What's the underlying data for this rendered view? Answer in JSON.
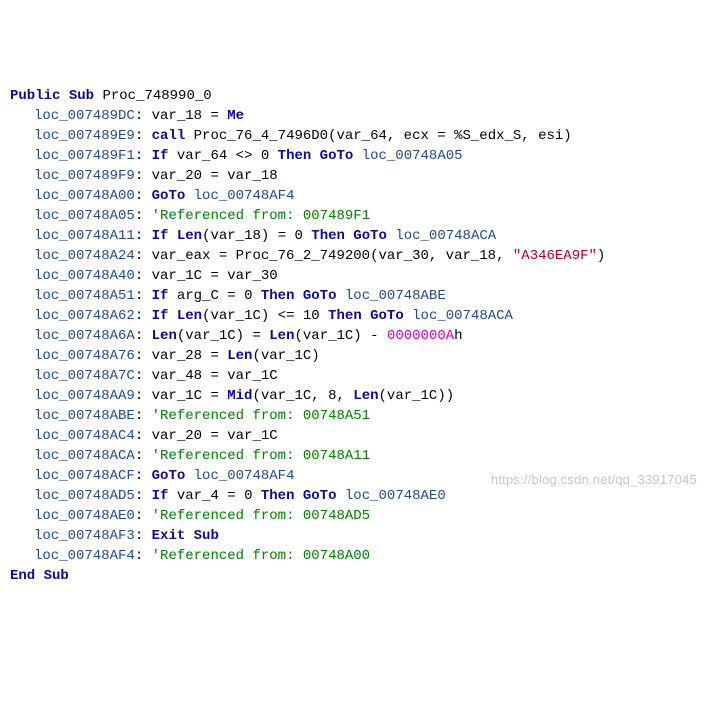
{
  "watermark": "https://blog.csdn.net/qq_33917045",
  "lines": [
    {
      "indent": false,
      "tokens": [
        {
          "t": "Public",
          "c": "kw"
        },
        {
          "t": " ",
          "c": "txt"
        },
        {
          "t": "Sub",
          "c": "kw"
        },
        {
          "t": " Proc_748990_0",
          "c": "txt"
        }
      ]
    },
    {
      "indent": true,
      "tokens": [
        {
          "t": "loc_007489DC",
          "c": "loc"
        },
        {
          "t": ": var_18 = ",
          "c": "txt"
        },
        {
          "t": "Me",
          "c": "kw"
        }
      ]
    },
    {
      "indent": true,
      "tokens": [
        {
          "t": "loc_007489E9",
          "c": "loc"
        },
        {
          "t": ": ",
          "c": "txt"
        },
        {
          "t": "call",
          "c": "kw"
        },
        {
          "t": " Proc_76_4_7496D0(var_64, ecx = %S_edx_S, esi)",
          "c": "txt"
        }
      ]
    },
    {
      "indent": true,
      "tokens": [
        {
          "t": "loc_007489F1",
          "c": "loc"
        },
        {
          "t": ": ",
          "c": "txt"
        },
        {
          "t": "If",
          "c": "kw"
        },
        {
          "t": " var_64 <> 0 ",
          "c": "txt"
        },
        {
          "t": "Then GoTo",
          "c": "kw"
        },
        {
          "t": " ",
          "c": "txt"
        },
        {
          "t": "loc_00748A05",
          "c": "loc"
        }
      ]
    },
    {
      "indent": true,
      "tokens": [
        {
          "t": "loc_007489F9",
          "c": "loc"
        },
        {
          "t": ": var_20 = var_18",
          "c": "txt"
        }
      ]
    },
    {
      "indent": true,
      "tokens": [
        {
          "t": "loc_00748A00",
          "c": "loc"
        },
        {
          "t": ": ",
          "c": "txt"
        },
        {
          "t": "GoTo",
          "c": "kw"
        },
        {
          "t": " ",
          "c": "txt"
        },
        {
          "t": "loc_00748AF4",
          "c": "loc"
        }
      ]
    },
    {
      "indent": true,
      "tokens": [
        {
          "t": "loc_00748A05",
          "c": "loc"
        },
        {
          "t": ": ",
          "c": "txt"
        },
        {
          "t": "'Referenced from: 007489F1",
          "c": "cm"
        }
      ]
    },
    {
      "indent": true,
      "tokens": [
        {
          "t": "loc_00748A11",
          "c": "loc"
        },
        {
          "t": ": ",
          "c": "txt"
        },
        {
          "t": "If",
          "c": "kw"
        },
        {
          "t": " ",
          "c": "txt"
        },
        {
          "t": "Len",
          "c": "kw"
        },
        {
          "t": "(var_18) = 0 ",
          "c": "txt"
        },
        {
          "t": "Then GoTo",
          "c": "kw"
        },
        {
          "t": " ",
          "c": "txt"
        },
        {
          "t": "loc_00748ACA",
          "c": "loc"
        }
      ]
    },
    {
      "indent": true,
      "tokens": [
        {
          "t": "loc_00748A24",
          "c": "loc"
        },
        {
          "t": ": var_eax = Proc_76_2_749200(var_30, var_18, ",
          "c": "txt"
        },
        {
          "t": "\"A346EA9F\"",
          "c": "str"
        },
        {
          "t": ")",
          "c": "txt"
        }
      ]
    },
    {
      "indent": true,
      "tokens": [
        {
          "t": "loc_00748A40",
          "c": "loc"
        },
        {
          "t": ": var_1C = var_30",
          "c": "txt"
        }
      ]
    },
    {
      "indent": true,
      "tokens": [
        {
          "t": "loc_00748A51",
          "c": "loc"
        },
        {
          "t": ": ",
          "c": "txt"
        },
        {
          "t": "If",
          "c": "kw"
        },
        {
          "t": " arg_C = 0 ",
          "c": "txt"
        },
        {
          "t": "Then GoTo",
          "c": "kw"
        },
        {
          "t": " ",
          "c": "txt"
        },
        {
          "t": "loc_00748ABE",
          "c": "loc"
        }
      ]
    },
    {
      "indent": true,
      "tokens": [
        {
          "t": "loc_00748A62",
          "c": "loc"
        },
        {
          "t": ": ",
          "c": "txt"
        },
        {
          "t": "If",
          "c": "kw"
        },
        {
          "t": " ",
          "c": "txt"
        },
        {
          "t": "Len",
          "c": "kw"
        },
        {
          "t": "(var_1C) <= 10 ",
          "c": "txt"
        },
        {
          "t": "Then GoTo",
          "c": "kw"
        },
        {
          "t": " ",
          "c": "txt"
        },
        {
          "t": "loc_00748ACA",
          "c": "loc"
        }
      ]
    },
    {
      "indent": true,
      "tokens": [
        {
          "t": "loc_00748A6A",
          "c": "loc"
        },
        {
          "t": ": ",
          "c": "txt"
        },
        {
          "t": "Len",
          "c": "kw"
        },
        {
          "t": "(var_1C) = ",
          "c": "txt"
        },
        {
          "t": "Len",
          "c": "kw"
        },
        {
          "t": "(var_1C) - ",
          "c": "txt"
        },
        {
          "t": "0000000A",
          "c": "num"
        },
        {
          "t": "h",
          "c": "txt"
        }
      ]
    },
    {
      "indent": true,
      "tokens": [
        {
          "t": "loc_00748A76",
          "c": "loc"
        },
        {
          "t": ": var_28 = ",
          "c": "txt"
        },
        {
          "t": "Len",
          "c": "kw"
        },
        {
          "t": "(var_1C)",
          "c": "txt"
        }
      ]
    },
    {
      "indent": true,
      "tokens": [
        {
          "t": "loc_00748A7C",
          "c": "loc"
        },
        {
          "t": ": var_48 = var_1C",
          "c": "txt"
        }
      ]
    },
    {
      "indent": true,
      "tokens": [
        {
          "t": "loc_00748AA9",
          "c": "loc"
        },
        {
          "t": ": var_1C = ",
          "c": "txt"
        },
        {
          "t": "Mid",
          "c": "kw"
        },
        {
          "t": "(var_1C, 8, ",
          "c": "txt"
        },
        {
          "t": "Len",
          "c": "kw"
        },
        {
          "t": "(var_1C))",
          "c": "txt"
        }
      ]
    },
    {
      "indent": true,
      "tokens": [
        {
          "t": "loc_00748ABE",
          "c": "loc"
        },
        {
          "t": ": ",
          "c": "txt"
        },
        {
          "t": "'Referenced from: 00748A51",
          "c": "cm"
        }
      ]
    },
    {
      "indent": true,
      "tokens": [
        {
          "t": "loc_00748AC4",
          "c": "loc"
        },
        {
          "t": ": var_20 = var_1C",
          "c": "txt"
        }
      ]
    },
    {
      "indent": true,
      "tokens": [
        {
          "t": "loc_00748ACA",
          "c": "loc"
        },
        {
          "t": ": ",
          "c": "txt"
        },
        {
          "t": "'Referenced from: 00748A11",
          "c": "cm"
        }
      ]
    },
    {
      "indent": true,
      "tokens": [
        {
          "t": "loc_00748ACF",
          "c": "loc"
        },
        {
          "t": ": ",
          "c": "txt"
        },
        {
          "t": "GoTo",
          "c": "kw"
        },
        {
          "t": " ",
          "c": "txt"
        },
        {
          "t": "loc_00748AF4",
          "c": "loc"
        }
      ]
    },
    {
      "indent": true,
      "tokens": [
        {
          "t": "loc_00748AD5",
          "c": "loc"
        },
        {
          "t": ": ",
          "c": "txt"
        },
        {
          "t": "If",
          "c": "kw"
        },
        {
          "t": " var_4 = 0 ",
          "c": "txt"
        },
        {
          "t": "Then GoTo",
          "c": "kw"
        },
        {
          "t": " ",
          "c": "txt"
        },
        {
          "t": "loc_00748AE0",
          "c": "loc"
        }
      ]
    },
    {
      "indent": true,
      "tokens": [
        {
          "t": "loc_00748AE0",
          "c": "loc"
        },
        {
          "t": ": ",
          "c": "txt"
        },
        {
          "t": "'Referenced from: 00748AD5",
          "c": "cm"
        }
      ]
    },
    {
      "indent": true,
      "tokens": [
        {
          "t": "loc_00748AF3",
          "c": "loc"
        },
        {
          "t": ": ",
          "c": "txt"
        },
        {
          "t": "Exit Sub",
          "c": "kw"
        }
      ]
    },
    {
      "indent": true,
      "tokens": [
        {
          "t": "loc_00748AF4",
          "c": "loc"
        },
        {
          "t": ": ",
          "c": "txt"
        },
        {
          "t": "'Referenced from: 00748A00",
          "c": "cm"
        }
      ]
    },
    {
      "indent": false,
      "tokens": [
        {
          "t": "End Sub",
          "c": "kw"
        }
      ]
    }
  ]
}
